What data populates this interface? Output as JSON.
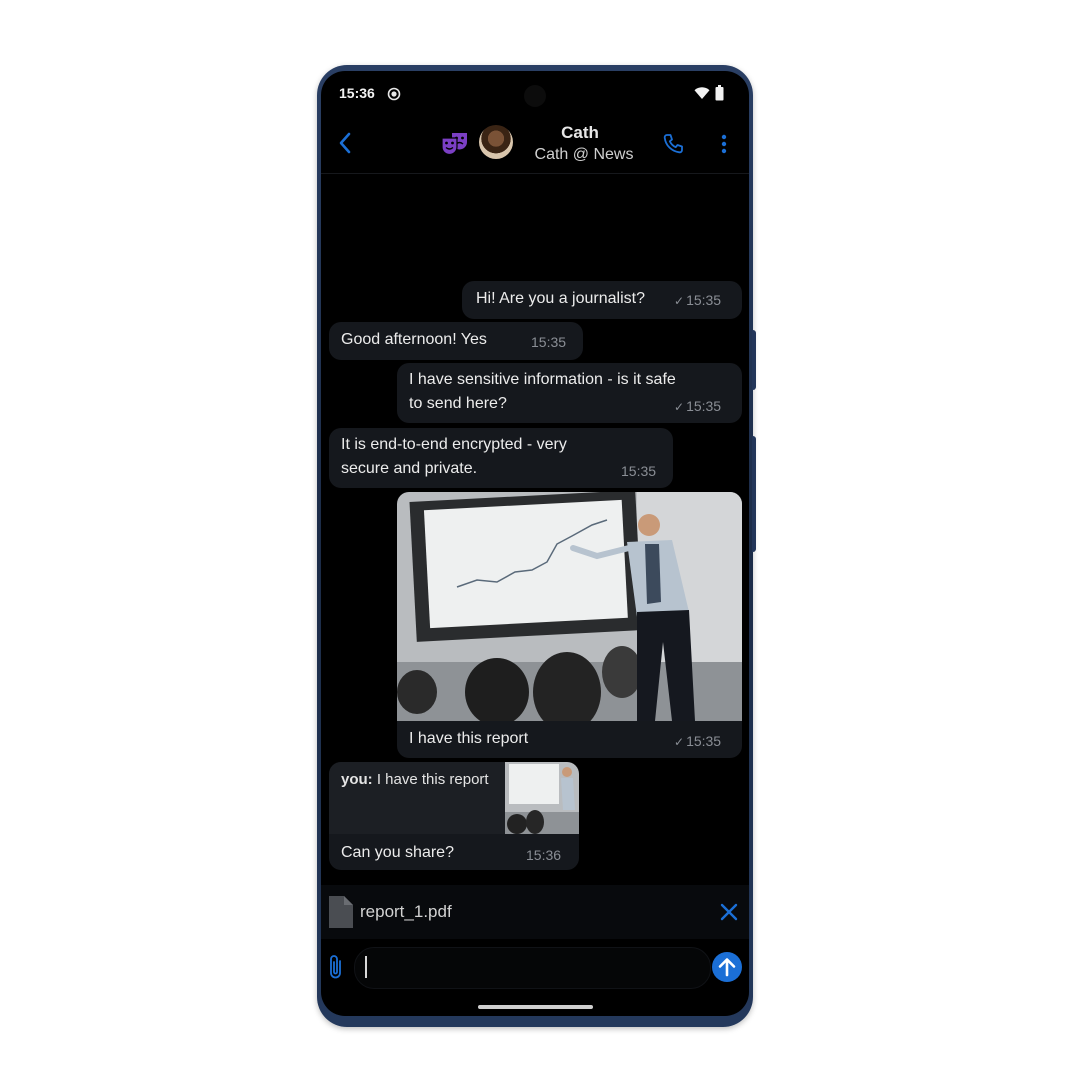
{
  "status_bar": {
    "time": "15:36"
  },
  "header": {
    "contact_name": "Cath",
    "contact_subtitle": "Cath @ News"
  },
  "messages": [
    {
      "direction": "outgoing",
      "text": "Hi! Are you a journalist?",
      "time": "15:35",
      "status": "✓"
    },
    {
      "direction": "incoming",
      "text": "Good afternoon! Yes",
      "time": "15:35"
    },
    {
      "direction": "outgoing",
      "text_lines": [
        "I have sensitive information - is it safe",
        "to send here?"
      ],
      "time": "15:35",
      "status": "✓"
    },
    {
      "direction": "incoming",
      "text_lines": [
        "It is end-to-end encrypted - very",
        "secure and private."
      ],
      "time": "15:35"
    },
    {
      "direction": "outgoing",
      "type": "image",
      "caption": "I have this report",
      "time": "15:35",
      "status": "✓"
    },
    {
      "direction": "incoming",
      "quote": {
        "author": "you",
        "separator": ":",
        "text": "I have this report"
      },
      "text": "Can you share?",
      "time": "15:36"
    }
  ],
  "attachment": {
    "file_name": "report_1.pdf"
  },
  "composer": {
    "value": "",
    "placeholder": ""
  },
  "colors": {
    "accent": "#1b6fd6",
    "mask_icon": "#7b3fc4",
    "background": "#000000",
    "bubble": "#15181d"
  },
  "icons": [
    "back-arrow-icon",
    "theater-masks-icon",
    "phone-icon",
    "more-vertical-icon",
    "paperclip-icon",
    "send-arrow-icon",
    "document-icon",
    "close-icon",
    "wifi-icon",
    "battery-icon",
    "screen-record-icon"
  ]
}
